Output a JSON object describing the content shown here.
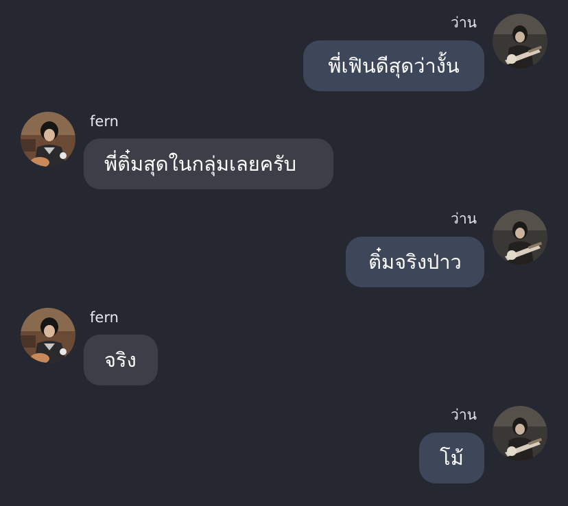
{
  "colors": {
    "background": "#252831",
    "outgoing_bubble": "#3e4659",
    "incoming_bubble": "#3c3f48",
    "text": "#ffffff",
    "name_text": "#e6e8ee"
  },
  "messages": [
    {
      "sender": "ว่าน",
      "direction": "outgoing",
      "text": "พี่เฟินดีสุดว่างั้น",
      "avatar": "guitar-player-avatar"
    },
    {
      "sender": "fern",
      "direction": "incoming",
      "text": "พี่ติ๋มสุดในกลุ่มเลยครับ",
      "avatar": "fern-avatar"
    },
    {
      "sender": "ว่าน",
      "direction": "outgoing",
      "text": "ติ๋มจริงป่าว",
      "avatar": "guitar-player-avatar"
    },
    {
      "sender": "fern",
      "direction": "incoming",
      "text": "จริง",
      "avatar": "fern-avatar"
    },
    {
      "sender": "ว่าน",
      "direction": "outgoing",
      "text": "โม้",
      "avatar": "guitar-player-avatar"
    }
  ]
}
